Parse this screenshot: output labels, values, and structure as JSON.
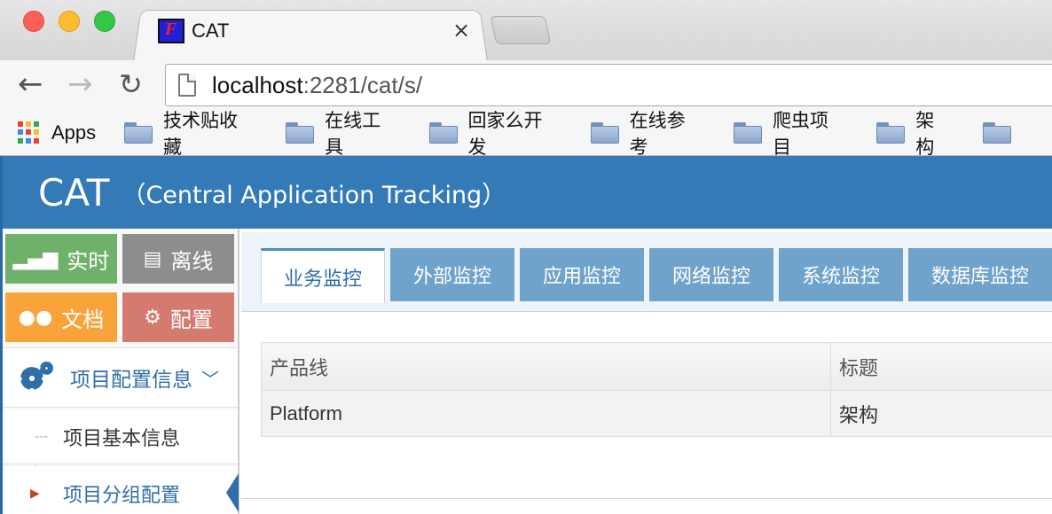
{
  "browser": {
    "tab_title": "CAT",
    "tab_close": "×",
    "url_host": "localhost",
    "url_rest": ":2281/cat/s/",
    "apps_label": "Apps",
    "bookmarks": [
      "技术贴收藏",
      "在线工具",
      "回家么开发",
      "在线参考",
      "爬虫项目",
      "架构"
    ]
  },
  "header": {
    "brand": "CAT",
    "subtitle": "（Central Application Tracking）",
    "color": "#337ab7"
  },
  "sidebar": {
    "shortcuts": [
      {
        "label": "实时",
        "icon": "signal-bars-icon",
        "color": "#6fb06a"
      },
      {
        "label": "离线",
        "icon": "film-icon",
        "color": "#8d8d8d"
      },
      {
        "label": "文档",
        "icon": "users-icon",
        "color": "#f9a43b"
      },
      {
        "label": "配置",
        "icon": "gears-icon",
        "color": "#d57a6e"
      }
    ],
    "section": {
      "label": "项目配置信息",
      "icon": "gears-icon"
    },
    "items": [
      {
        "label": "项目基本信息",
        "active": false
      },
      {
        "label": "项目分组配置",
        "active": true
      }
    ]
  },
  "main": {
    "tabs": [
      "业务监控",
      "外部监控",
      "应用监控",
      "网络监控",
      "系统监控",
      "数据库监控"
    ],
    "active_tab": 0,
    "table": {
      "headers": [
        "产品线",
        "标题"
      ],
      "rows": [
        [
          "Platform",
          "架构"
        ]
      ]
    }
  }
}
